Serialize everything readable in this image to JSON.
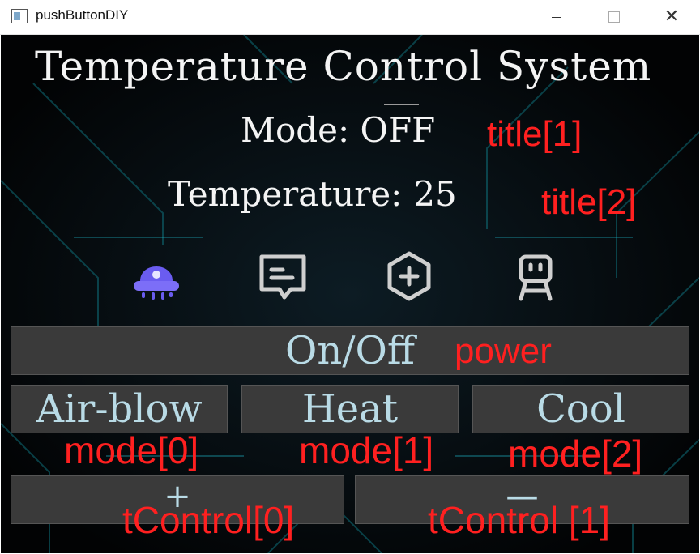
{
  "window": {
    "title": "pushButtonDIY",
    "controls": {
      "minimize": "minimize",
      "maximize": "maximize",
      "close": "close"
    }
  },
  "main": {
    "title": "Temperature Control System",
    "mode_label": "Mode:",
    "mode_value": "OFF",
    "temperature_label": "Temperature:",
    "temperature_value": "25",
    "icons": [
      "alien-icon",
      "message-icon",
      "plus-hexagon-icon",
      "robot-icon"
    ],
    "buttons": {
      "power": "On/Off",
      "air_blow": "Air-blow",
      "heat": "Heat",
      "cool": "Cool",
      "increase": "+",
      "decrease": "—"
    }
  },
  "annotations": {
    "title1": "title[1]",
    "title2": "title[2]",
    "power": "power",
    "mode0": "mode[0]",
    "mode1": "mode[1]",
    "mode2": "mode[2]",
    "tcontrol0": "tControl[0]",
    "tcontrol1": "tControl [1]"
  },
  "colors": {
    "background": "#050608",
    "button_bg": "#3a3a3a",
    "button_text": "#b9dbe6",
    "annotation": "#ff2020",
    "active_icon": "#6a5cf0",
    "inactive_icon": "#cfcfcf"
  }
}
